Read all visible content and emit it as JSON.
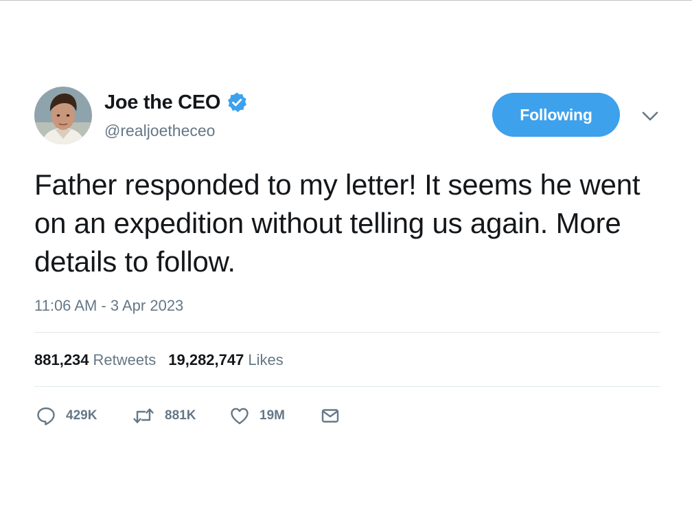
{
  "user": {
    "display_name": "Joe the CEO",
    "handle": "@realjoetheceo",
    "verified": true,
    "avatar": "profile-photo"
  },
  "follow_button": {
    "label": "Following"
  },
  "tweet": {
    "text": "Father responded to my letter! It seems he went on an expedition without telling us again. More details to follow.",
    "timestamp": "11:06 AM - 3 Apr 2023"
  },
  "stats": {
    "retweets_count": "881,234",
    "retweets_label": "Retweets",
    "likes_count": "19,282,747",
    "likes_label": "Likes"
  },
  "actions": {
    "reply": {
      "icon": "reply-icon",
      "count": "429K"
    },
    "retweet": {
      "icon": "retweet-icon",
      "count": "881K"
    },
    "like": {
      "icon": "heart-icon",
      "count": "19M"
    },
    "message": {
      "icon": "envelope-icon"
    }
  },
  "colors": {
    "accent": "#3ea1ec",
    "text": "#14171a",
    "secondary": "#657786",
    "divider": "#e1e8ed"
  }
}
